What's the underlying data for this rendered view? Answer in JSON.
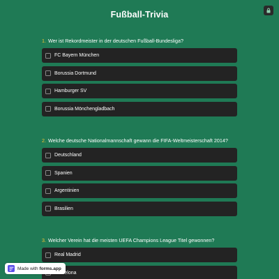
{
  "window": {
    "title": "Fußball-Trivia"
  },
  "corner_button": {
    "icon": "lock-icon"
  },
  "questions": [
    {
      "number": "1.",
      "text": "Wer ist Rekordmeister in der deutschen Fußball-Bundesliga?",
      "options": [
        "FC Bayern München",
        "Borussia Dortmund",
        "Hamburger SV",
        "Borussia Mönchengladbach"
      ]
    },
    {
      "number": "2.",
      "text": "Welche deutsche Nationalmannschaft gewann die FIFA-Weltmeisterschaft 2014?",
      "options": [
        "Deutschland",
        "Spanien",
        "Argentinien",
        "Brasilien"
      ]
    },
    {
      "number": "3.",
      "text": "Welcher Verein hat die meisten UEFA Champions League Titel gewonnen?",
      "options": [
        "Real Madrid",
        "Barcelona"
      ]
    }
  ],
  "badge": {
    "prefix": "Made with",
    "brand": "forms.app",
    "icon": "forms-app-logo-icon"
  },
  "colors": {
    "background": "#1f7a55",
    "option_bg": "#232323",
    "accent": "#f4c531",
    "brand": "#5b4ee8"
  }
}
